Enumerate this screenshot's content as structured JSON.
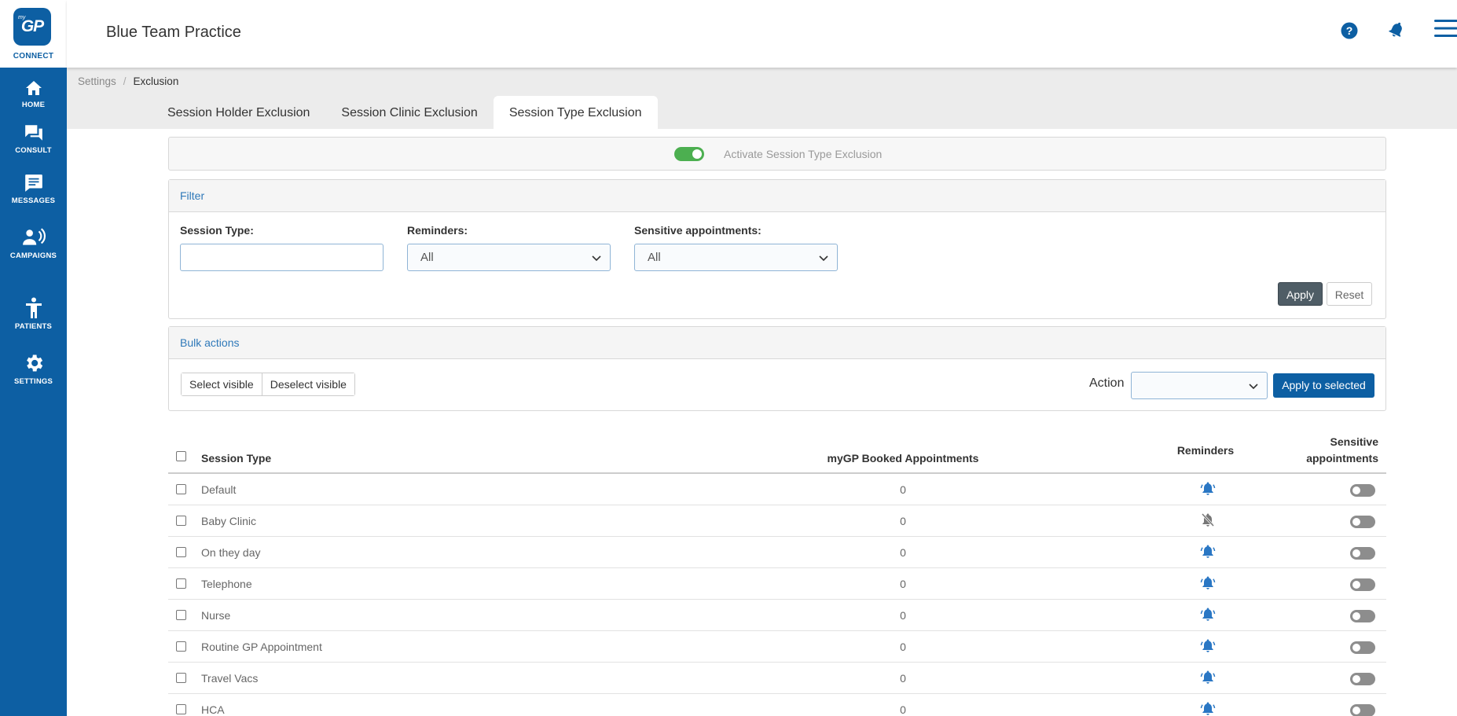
{
  "brand": {
    "logo_small": "my",
    "logo_main": "GP",
    "logo_caption": "CONNECT"
  },
  "header": {
    "title": "Blue Team Practice",
    "icons": [
      "help-icon",
      "bell-icon",
      "hamburger-menu-icon"
    ]
  },
  "sidebar": {
    "items": [
      {
        "label": "HOME",
        "icon": "home-icon"
      },
      {
        "label": "CONSULT",
        "icon": "chat-icon"
      },
      {
        "label": "MESSAGES",
        "icon": "message-icon"
      },
      {
        "label": "CAMPAIGNS",
        "icon": "campaign-icon"
      },
      {
        "label": "PATIENTS",
        "icon": "person-icon"
      },
      {
        "label": "SETTINGS",
        "icon": "gear-icon"
      }
    ]
  },
  "breadcrumb": {
    "parent": "Settings",
    "separator": "/",
    "current": "Exclusion"
  },
  "tabs": [
    {
      "label": "Session Holder Exclusion",
      "active": false
    },
    {
      "label": "Session Clinic Exclusion",
      "active": false
    },
    {
      "label": "Session Type Exclusion",
      "active": true
    }
  ],
  "activate": {
    "label": "Activate Session Type Exclusion",
    "enabled": true
  },
  "filter": {
    "title": "Filter",
    "session_type_label": "Session Type:",
    "session_type_value": "",
    "reminders_label": "Reminders:",
    "reminders_value": "All",
    "sensitive_label": "Sensitive appointments:",
    "sensitive_value": "All",
    "apply_label": "Apply",
    "reset_label": "Reset"
  },
  "bulk": {
    "title": "Bulk actions",
    "select_visible": "Select visible",
    "deselect_visible": "Deselect visible",
    "action_label": "Action",
    "action_value": "",
    "apply_selected": "Apply to selected"
  },
  "table": {
    "headers": {
      "session_type": "Session Type",
      "booked": "myGP Booked Appointments",
      "reminders": "Reminders",
      "sensitive_line1": "Sensitive",
      "sensitive_line2": "appointments"
    },
    "rows": [
      {
        "name": "Default",
        "count": "0",
        "reminders": true,
        "sensitive": false
      },
      {
        "name": "Baby Clinic",
        "count": "0",
        "reminders": false,
        "sensitive": false
      },
      {
        "name": "On they day",
        "count": "0",
        "reminders": true,
        "sensitive": false
      },
      {
        "name": "Telephone",
        "count": "0",
        "reminders": true,
        "sensitive": false
      },
      {
        "name": "Nurse",
        "count": "0",
        "reminders": true,
        "sensitive": false
      },
      {
        "name": "Routine GP Appointment",
        "count": "0",
        "reminders": true,
        "sensitive": false
      },
      {
        "name": "Travel Vacs",
        "count": "0",
        "reminders": true,
        "sensitive": false
      },
      {
        "name": "HCA",
        "count": "0",
        "reminders": true,
        "sensitive": false
      }
    ]
  },
  "colors": {
    "brand_blue": "#0d5fa3",
    "toggle_on": "#4caf50",
    "toggle_off": "#8d8d8d",
    "bell_on": "#2a77c4",
    "bell_off": "#777777"
  }
}
